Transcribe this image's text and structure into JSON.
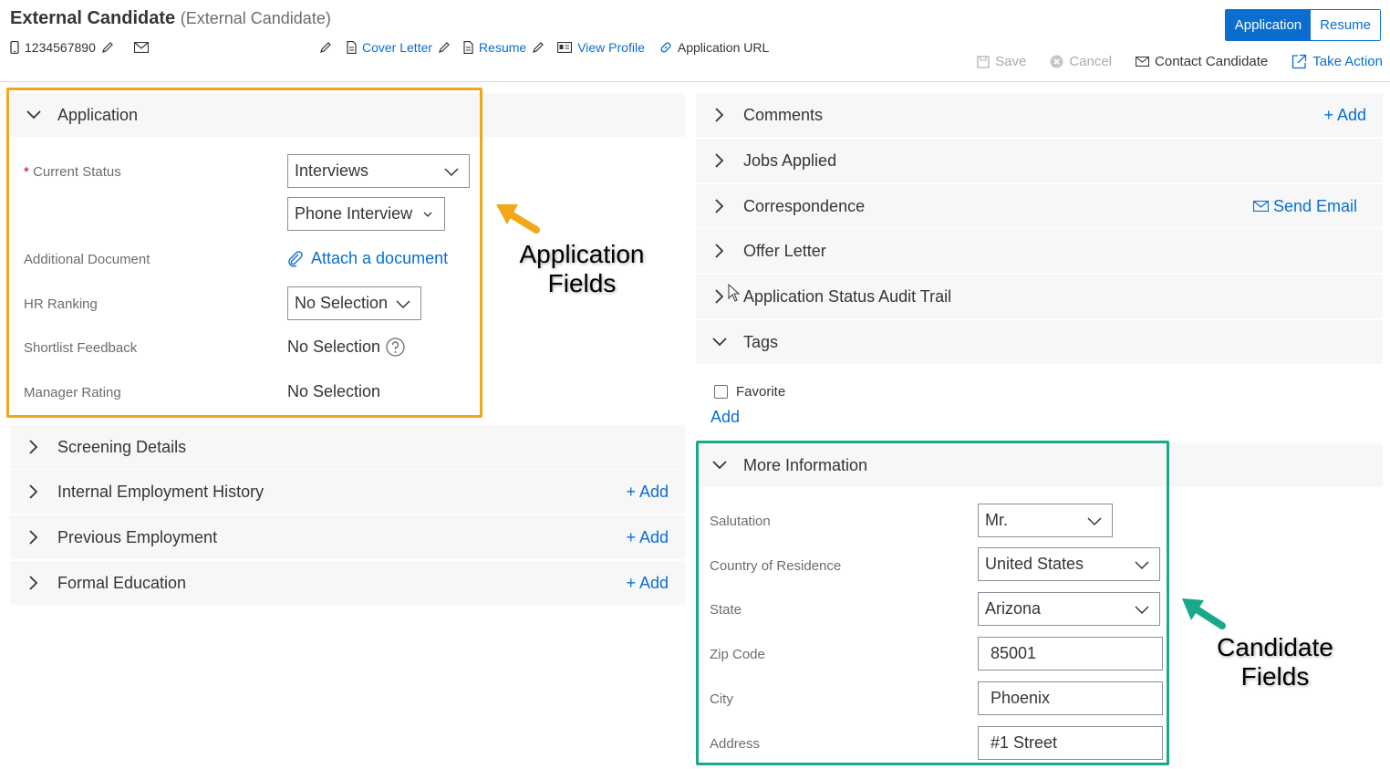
{
  "header": {
    "name": "External Candidate",
    "subtitle": "(External Candidate)",
    "phone": "1234567890",
    "links": {
      "cover_letter": "Cover Letter",
      "resume": "Resume",
      "view_profile": "View Profile",
      "application_url": "Application URL"
    },
    "segments": {
      "application": "Application",
      "resume": "Resume"
    },
    "actions": {
      "save": "Save",
      "cancel": "Cancel",
      "contact": "Contact Candidate",
      "take_action": "Take Action"
    }
  },
  "left": {
    "application_panel": "Application",
    "fields": {
      "current_status_required": "*",
      "current_status_label": "Current Status",
      "current_status_value": "Interviews",
      "substatus_value": "Phone Interview",
      "additional_document_label": "Additional Document",
      "attach_link": "Attach a document",
      "hr_ranking_label": "HR Ranking",
      "hr_ranking_value": "No Selection",
      "shortlist_label": "Shortlist Feedback",
      "shortlist_value": "No Selection",
      "manager_rating_label": "Manager Rating",
      "manager_rating_value": "No Selection"
    },
    "panels": [
      {
        "label": "Screening Details",
        "add": ""
      },
      {
        "label": "Internal Employment History",
        "add": "+ Add"
      },
      {
        "label": "Previous Employment",
        "add": "+ Add"
      },
      {
        "label": "Formal Education",
        "add": "+ Add"
      }
    ]
  },
  "right": {
    "panels": [
      {
        "label": "Comments",
        "action": "+ Add"
      },
      {
        "label": "Jobs Applied",
        "action": ""
      },
      {
        "label": "Correspondence",
        "action": "Send Email"
      },
      {
        "label": "Offer Letter",
        "action": ""
      },
      {
        "label": "Application Status Audit Trail",
        "action": ""
      },
      {
        "label": "Tags",
        "action": ""
      }
    ],
    "tags": {
      "favorite": "Favorite",
      "add": "Add"
    },
    "more_info": {
      "title": "More Information",
      "salutation_label": "Salutation",
      "salutation_value": "Mr.",
      "country_label": "Country of Residence",
      "country_value": "United States",
      "state_label": "State",
      "state_value": "Arizona",
      "zip_label": "Zip Code",
      "zip_value": "85001",
      "city_label": "City",
      "city_value": "Phoenix",
      "address_label": "Address",
      "address_value": "#1 Street"
    }
  },
  "annotations": {
    "application_fields": "Application Fields",
    "candidate_fields": "Candidate Fields",
    "orange": "#f0a818",
    "green": "#19a98a"
  },
  "colors": {
    "accent": "#0a6ed1",
    "panel_bg": "#f7f7f7"
  }
}
